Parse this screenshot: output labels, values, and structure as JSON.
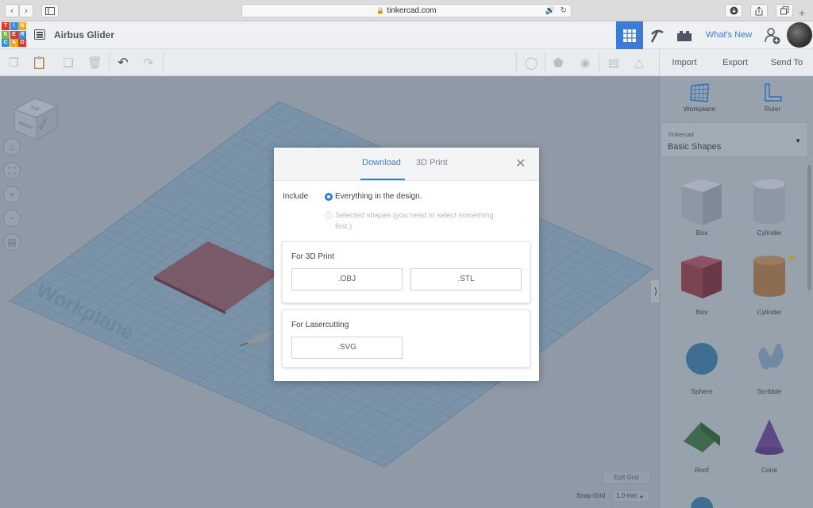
{
  "browser": {
    "url": "tinkercad.com"
  },
  "app": {
    "logo_letters": [
      "T",
      "I",
      "N",
      "K",
      "E",
      "R",
      "C",
      "A",
      "D"
    ],
    "logo_colors": [
      "#e3352b",
      "#3d8ed6",
      "#f2a81d",
      "#7ab648",
      "#e3352b",
      "#3d8ed6",
      "#3d8ed6",
      "#f2a81d",
      "#e3352b"
    ],
    "design_title": "Airbus Glider",
    "whats_new": "What's New",
    "accent": "#3b7bd8"
  },
  "right_toolbar": {
    "import": "Import",
    "export": "Export",
    "send_to": "Send To"
  },
  "right_panel": {
    "workplane_label": "Workplane",
    "ruler_label": "Ruler",
    "library_category": "Tinkercad",
    "library_name": "Basic Shapes",
    "shapes": [
      "Box",
      "Cylinder",
      "Box",
      "Cylinder",
      "Sphere",
      "Scribble",
      "Roof",
      "Cone"
    ]
  },
  "workspace": {
    "workplane_text": "Workplane",
    "edit_grid": "Edit Grid",
    "snap_grid_label": "Snap Grid",
    "snap_grid_value": "1.0 mm"
  },
  "view_cube": {
    "top": "TOP",
    "front": "FRONT",
    "right": "RIGHT"
  },
  "modal": {
    "tabs": [
      "Download",
      "3D Print"
    ],
    "active_tab": "Download",
    "include_label": "Include",
    "option_everything": "Everything in the design.",
    "option_selected": "Selected shapes (you need to select something first.)",
    "section_3d_print": "For 3D Print",
    "obj_button": ".OBJ",
    "stl_button": ".STL",
    "section_laser": "For Lasercutting",
    "svg_button": ".SVG"
  }
}
